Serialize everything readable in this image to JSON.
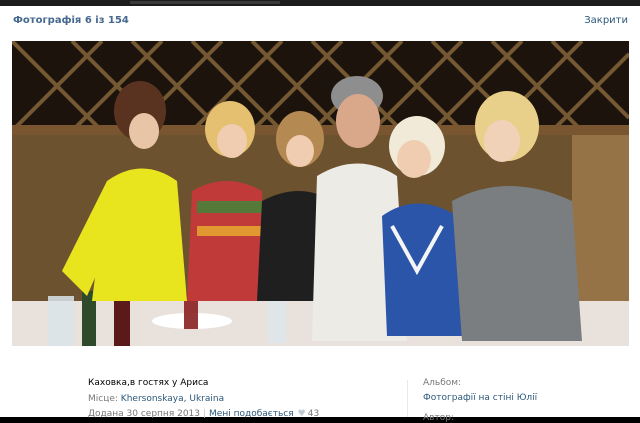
{
  "header": {
    "counter": "Фотографія 6 із 154",
    "close_label": "Закрити"
  },
  "photo": {
    "alt": "Photo"
  },
  "info": {
    "description": "Каховка,в гостях у Ариса",
    "place_label": "Місце:",
    "place_link": "Khersonskaya, Ukraina",
    "date": "Додана 30 серпня 2013",
    "like_link": "Мені подобається",
    "like_count": "43",
    "album_label": "Альбом:",
    "album_link": "Фотографії на стіні Юлії",
    "author_label": "Автор:"
  },
  "colors": {
    "link": "#2b587a",
    "muted": "#777777",
    "header_link": "#45688e"
  }
}
